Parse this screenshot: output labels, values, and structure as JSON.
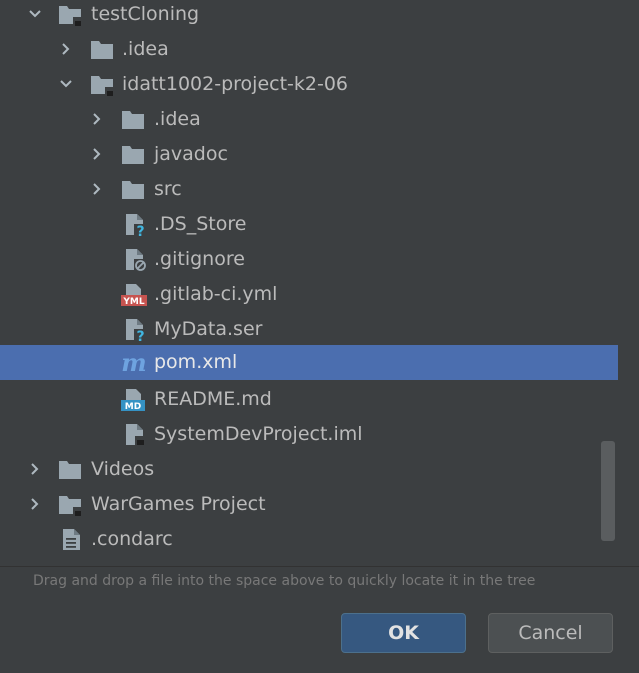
{
  "tree": {
    "items": [
      {
        "label": "testCloning",
        "icon": "module-folder-icon",
        "expanded": true
      },
      {
        "label": ".idea",
        "icon": "folder-icon",
        "expanded": false
      },
      {
        "label": "idatt1002-project-k2-06",
        "icon": "module-folder-icon",
        "expanded": true
      },
      {
        "label": ".idea",
        "icon": "folder-icon",
        "expanded": false
      },
      {
        "label": "javadoc",
        "icon": "folder-icon",
        "expanded": false
      },
      {
        "label": "src",
        "icon": "folder-icon",
        "expanded": false
      },
      {
        "label": ".DS_Store",
        "icon": "unknown-file-icon"
      },
      {
        "label": ".gitignore",
        "icon": "ignored-file-icon"
      },
      {
        "label": ".gitlab-ci.yml",
        "icon": "yaml-file-icon"
      },
      {
        "label": "MyData.ser",
        "icon": "unknown-file-icon"
      },
      {
        "label": "pom.xml",
        "icon": "maven-icon",
        "selected": true
      },
      {
        "label": "README.md",
        "icon": "markdown-file-icon"
      },
      {
        "label": "SystemDevProject.iml",
        "icon": "module-file-icon"
      },
      {
        "label": "Videos",
        "icon": "folder-icon",
        "expanded": false
      },
      {
        "label": "WarGames Project",
        "icon": "module-folder-icon",
        "expanded": false
      },
      {
        "label": ".condarc",
        "icon": "text-file-icon"
      }
    ]
  },
  "footer": {
    "hint": "Drag and drop a file into the space above to quickly locate it in the tree",
    "ok_label": "OK",
    "cancel_label": "Cancel"
  },
  "colors": {
    "background": "#3c3f41",
    "selection": "#4b6eaf",
    "folder": "#9aa7b0",
    "maven": "#6897bb",
    "yaml": "#c75450",
    "markdown": "#3592c4",
    "question": "#40b6e0"
  }
}
